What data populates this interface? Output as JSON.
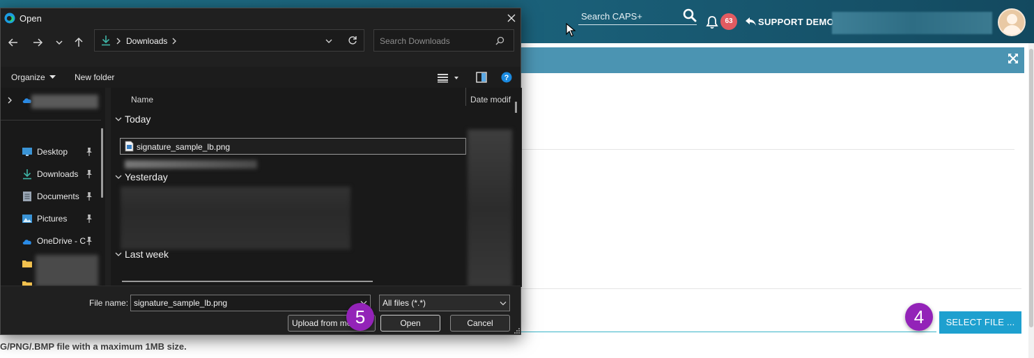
{
  "app": {
    "search_placeholder": "Search CAPS+",
    "notification_count": "63",
    "user_label": "SUPPORT DEMO",
    "select_file_label": "SELECT FILE ...",
    "file_hint": "G/PNG/.BMP file with a maximum 1MB size.",
    "step_select": "4",
    "step_open": "5",
    "colors": {
      "header": "#1a5f78",
      "panel_bar": "#4b94b2",
      "badge": "#e25b61",
      "select_button": "#1ea0cf",
      "step_marker": "#9323b8"
    }
  },
  "dialog": {
    "title": "Open",
    "address": {
      "location": "Downloads"
    },
    "search_placeholder": "Search Downloads",
    "toolbar": {
      "organize": "Organize",
      "new_folder": "New folder"
    },
    "nav_pane": {
      "items": [
        {
          "label": "Desktop",
          "icon": "desktop-icon",
          "pinned": true
        },
        {
          "label": "Downloads",
          "icon": "downloads-icon",
          "pinned": true
        },
        {
          "label": "Documents",
          "icon": "documents-icon",
          "pinned": true
        },
        {
          "label": "Pictures",
          "icon": "pictures-icon",
          "pinned": true
        },
        {
          "label": "OneDrive - C",
          "icon": "onedrive-icon",
          "pinned": true
        }
      ]
    },
    "file_list": {
      "columns": [
        "Name",
        "Date modif"
      ],
      "groups": [
        "Today",
        "Yesterday",
        "Last week"
      ],
      "selected_file": "signature_sample_lb.png"
    },
    "file_name_label": "File name:",
    "file_name_value": "signature_sample_lb.png",
    "file_type": "All files (*.*)",
    "buttons": {
      "upload": "Upload from mobile",
      "open": "Open",
      "cancel": "Cancel"
    }
  }
}
